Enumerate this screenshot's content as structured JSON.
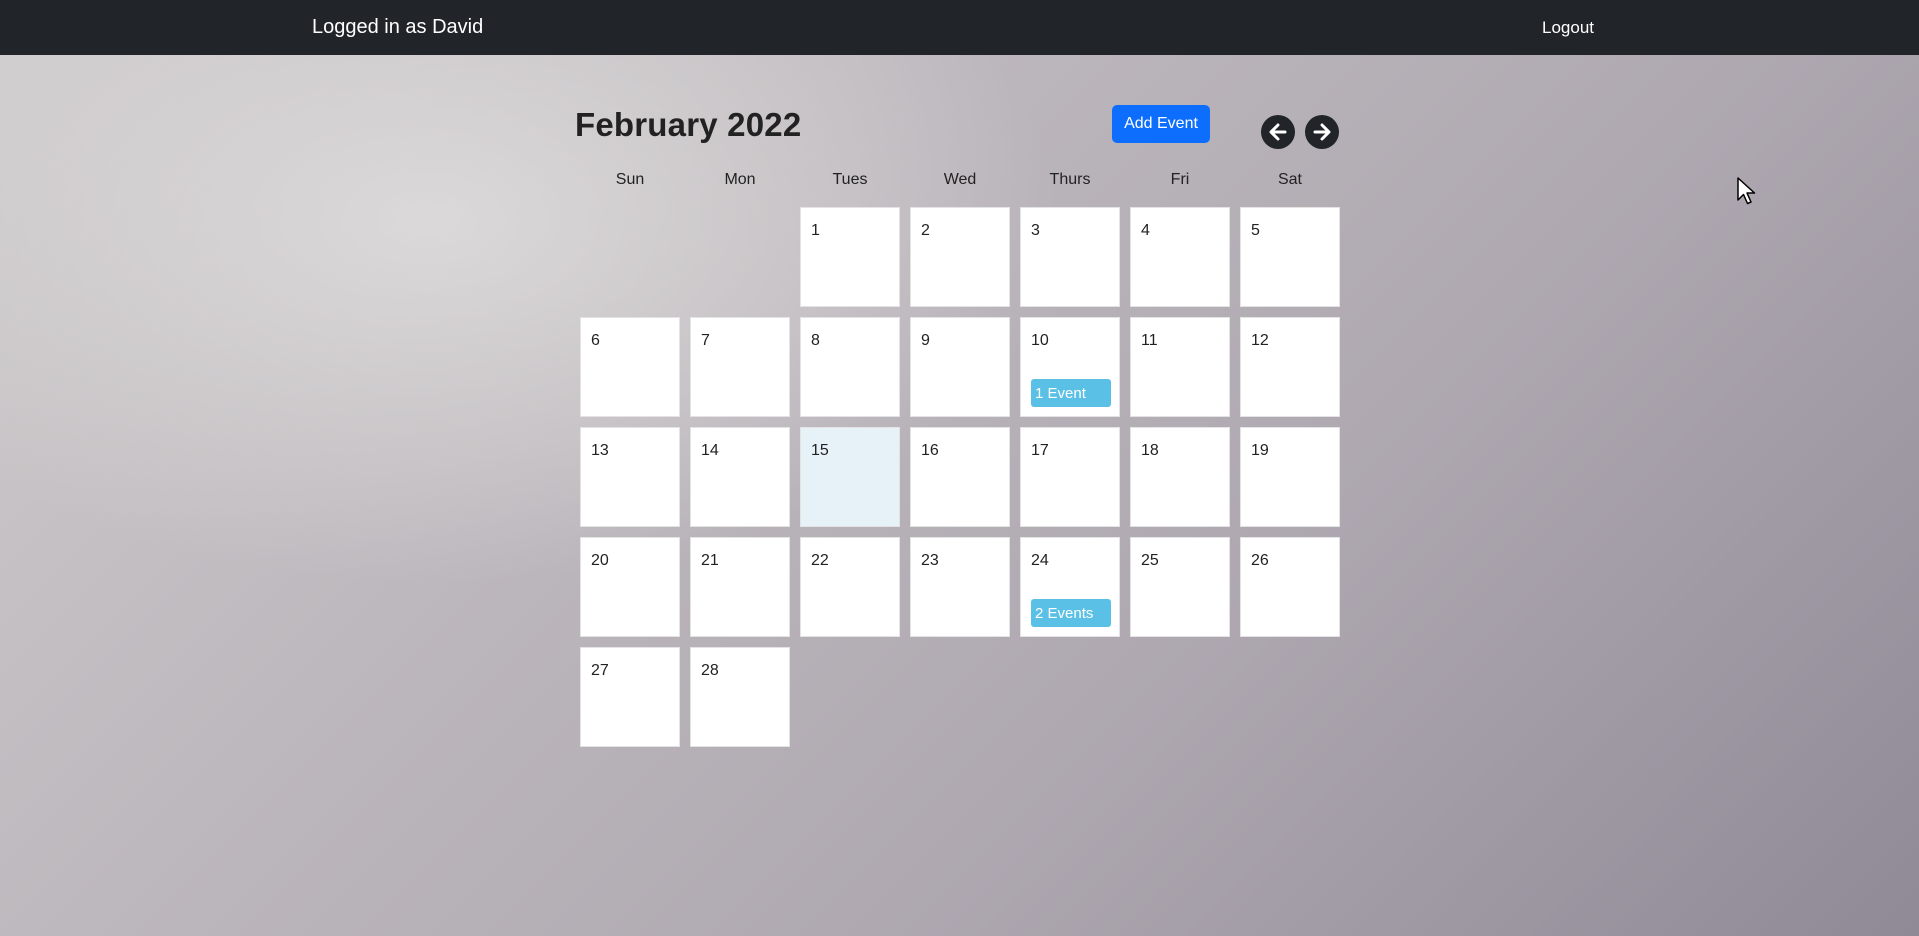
{
  "navbar": {
    "user_text": "Logged in as David",
    "logout_label": "Logout"
  },
  "calendar": {
    "month_title": "February 2022",
    "add_event_label": "Add Event",
    "prev_icon": "arrow-left-circle-icon",
    "next_icon": "arrow-right-circle-icon",
    "day_headers": [
      "Sun",
      "Mon",
      "Tues",
      "Wed",
      "Thurs",
      "Fri",
      "Sat"
    ],
    "first_weekday": 2,
    "days": [
      {
        "num": "1"
      },
      {
        "num": "2"
      },
      {
        "num": "3"
      },
      {
        "num": "4"
      },
      {
        "num": "5"
      },
      {
        "num": "6"
      },
      {
        "num": "7"
      },
      {
        "num": "8"
      },
      {
        "num": "9"
      },
      {
        "num": "10",
        "events": "1 Event"
      },
      {
        "num": "11"
      },
      {
        "num": "12"
      },
      {
        "num": "13"
      },
      {
        "num": "14"
      },
      {
        "num": "15",
        "today": true
      },
      {
        "num": "16"
      },
      {
        "num": "17"
      },
      {
        "num": "18"
      },
      {
        "num": "19"
      },
      {
        "num": "20"
      },
      {
        "num": "21"
      },
      {
        "num": "22"
      },
      {
        "num": "23"
      },
      {
        "num": "24",
        "events": "2 Events"
      },
      {
        "num": "25"
      },
      {
        "num": "26"
      },
      {
        "num": "27"
      },
      {
        "num": "28"
      }
    ]
  },
  "colors": {
    "navbar": "#212529",
    "accent": "#0d6efd",
    "event_badge": "#5bc0e6",
    "today_cell": "#e7f1f8"
  }
}
